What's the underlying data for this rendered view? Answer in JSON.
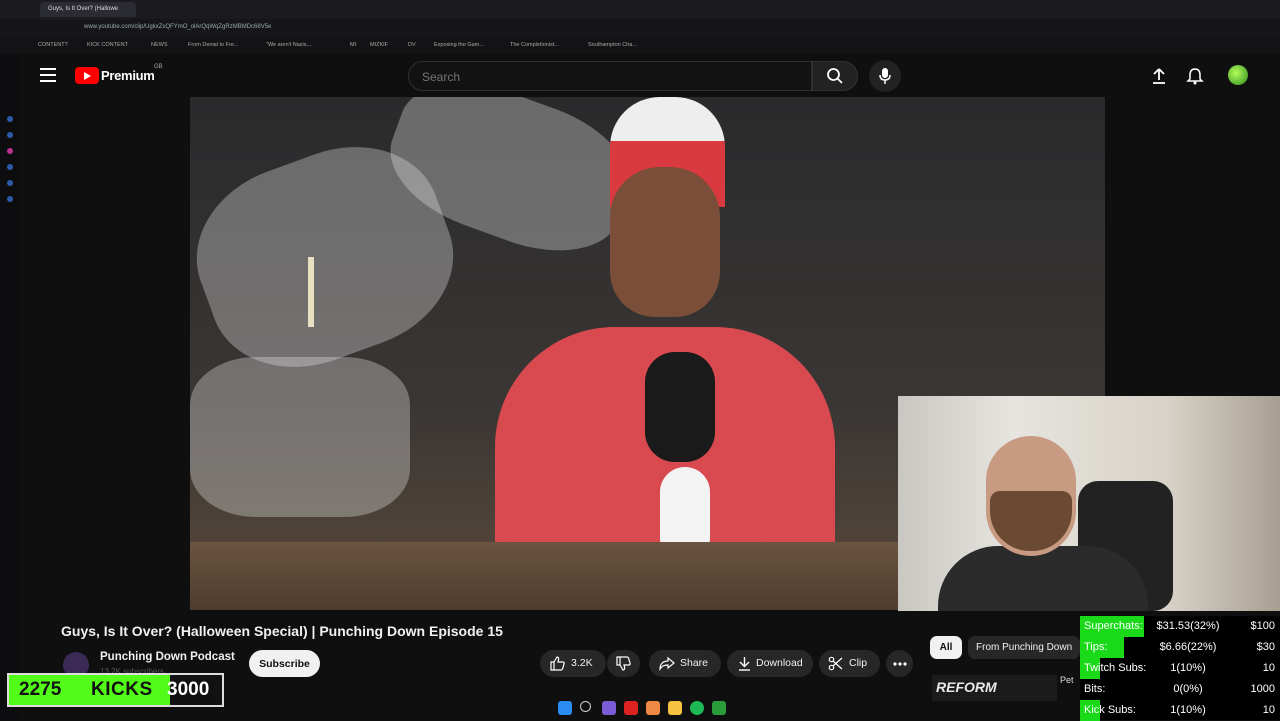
{
  "browser": {
    "tab_title": "Guys, Is It Over? (Hallowe",
    "url": "www.youtube.com/clip/UgkxZsQFYmO_olArQqWqZgRzMBMDc68V5e",
    "bookmarks": [
      "CONTENT?",
      "KICK CONTENT",
      "NEWS",
      "From Denial to Fre...",
      "\"We aren't Nazis,...",
      "MI",
      "MIZKIF",
      "DV",
      "Exposing the Gam...",
      "The Completionist...",
      "Southampton Cha..."
    ]
  },
  "header": {
    "brand": "Premium",
    "region": "GB",
    "search_placeholder": "Search"
  },
  "video": {
    "title": "Guys, Is It Over? (Halloween Special) | Punching Down Episode 15",
    "channel": "Punching Down Podcast",
    "subscribers": "13.2K subscribers",
    "subscribe_label": "Subscribe",
    "likes": "3.2K",
    "share_label": "Share",
    "download_label": "Download",
    "clip_label": "Clip"
  },
  "recommendations": {
    "chips": [
      "All",
      "From Punching Down"
    ],
    "thumb_text": "REFORM",
    "thumb_side_text": "Pet"
  },
  "kicks": {
    "count": "2275",
    "label": "KICKS",
    "goal": "3000",
    "progress_fraction": 0.758
  },
  "stats": [
    {
      "name": "Superchats:",
      "value": "$31.53(32%)",
      "goal": "$100",
      "fraction": 0.32
    },
    {
      "name": "Tips:",
      "value": "$6.66(22%)",
      "goal": "$30",
      "fraction": 0.22
    },
    {
      "name": "Twitch Subs:",
      "value": "1(10%)",
      "goal": "10",
      "fraction": 0.1
    },
    {
      "name": "Bits:",
      "value": "0(0%)",
      "goal": "1000",
      "fraction": 0.0
    },
    {
      "name": "Kick Subs:",
      "value": "1(10%)",
      "goal": "10",
      "fraction": 0.1
    }
  ],
  "colors": {
    "youtube_red": "#ff0000",
    "kick_green": "#53fc18",
    "stat_green": "#19d919"
  }
}
